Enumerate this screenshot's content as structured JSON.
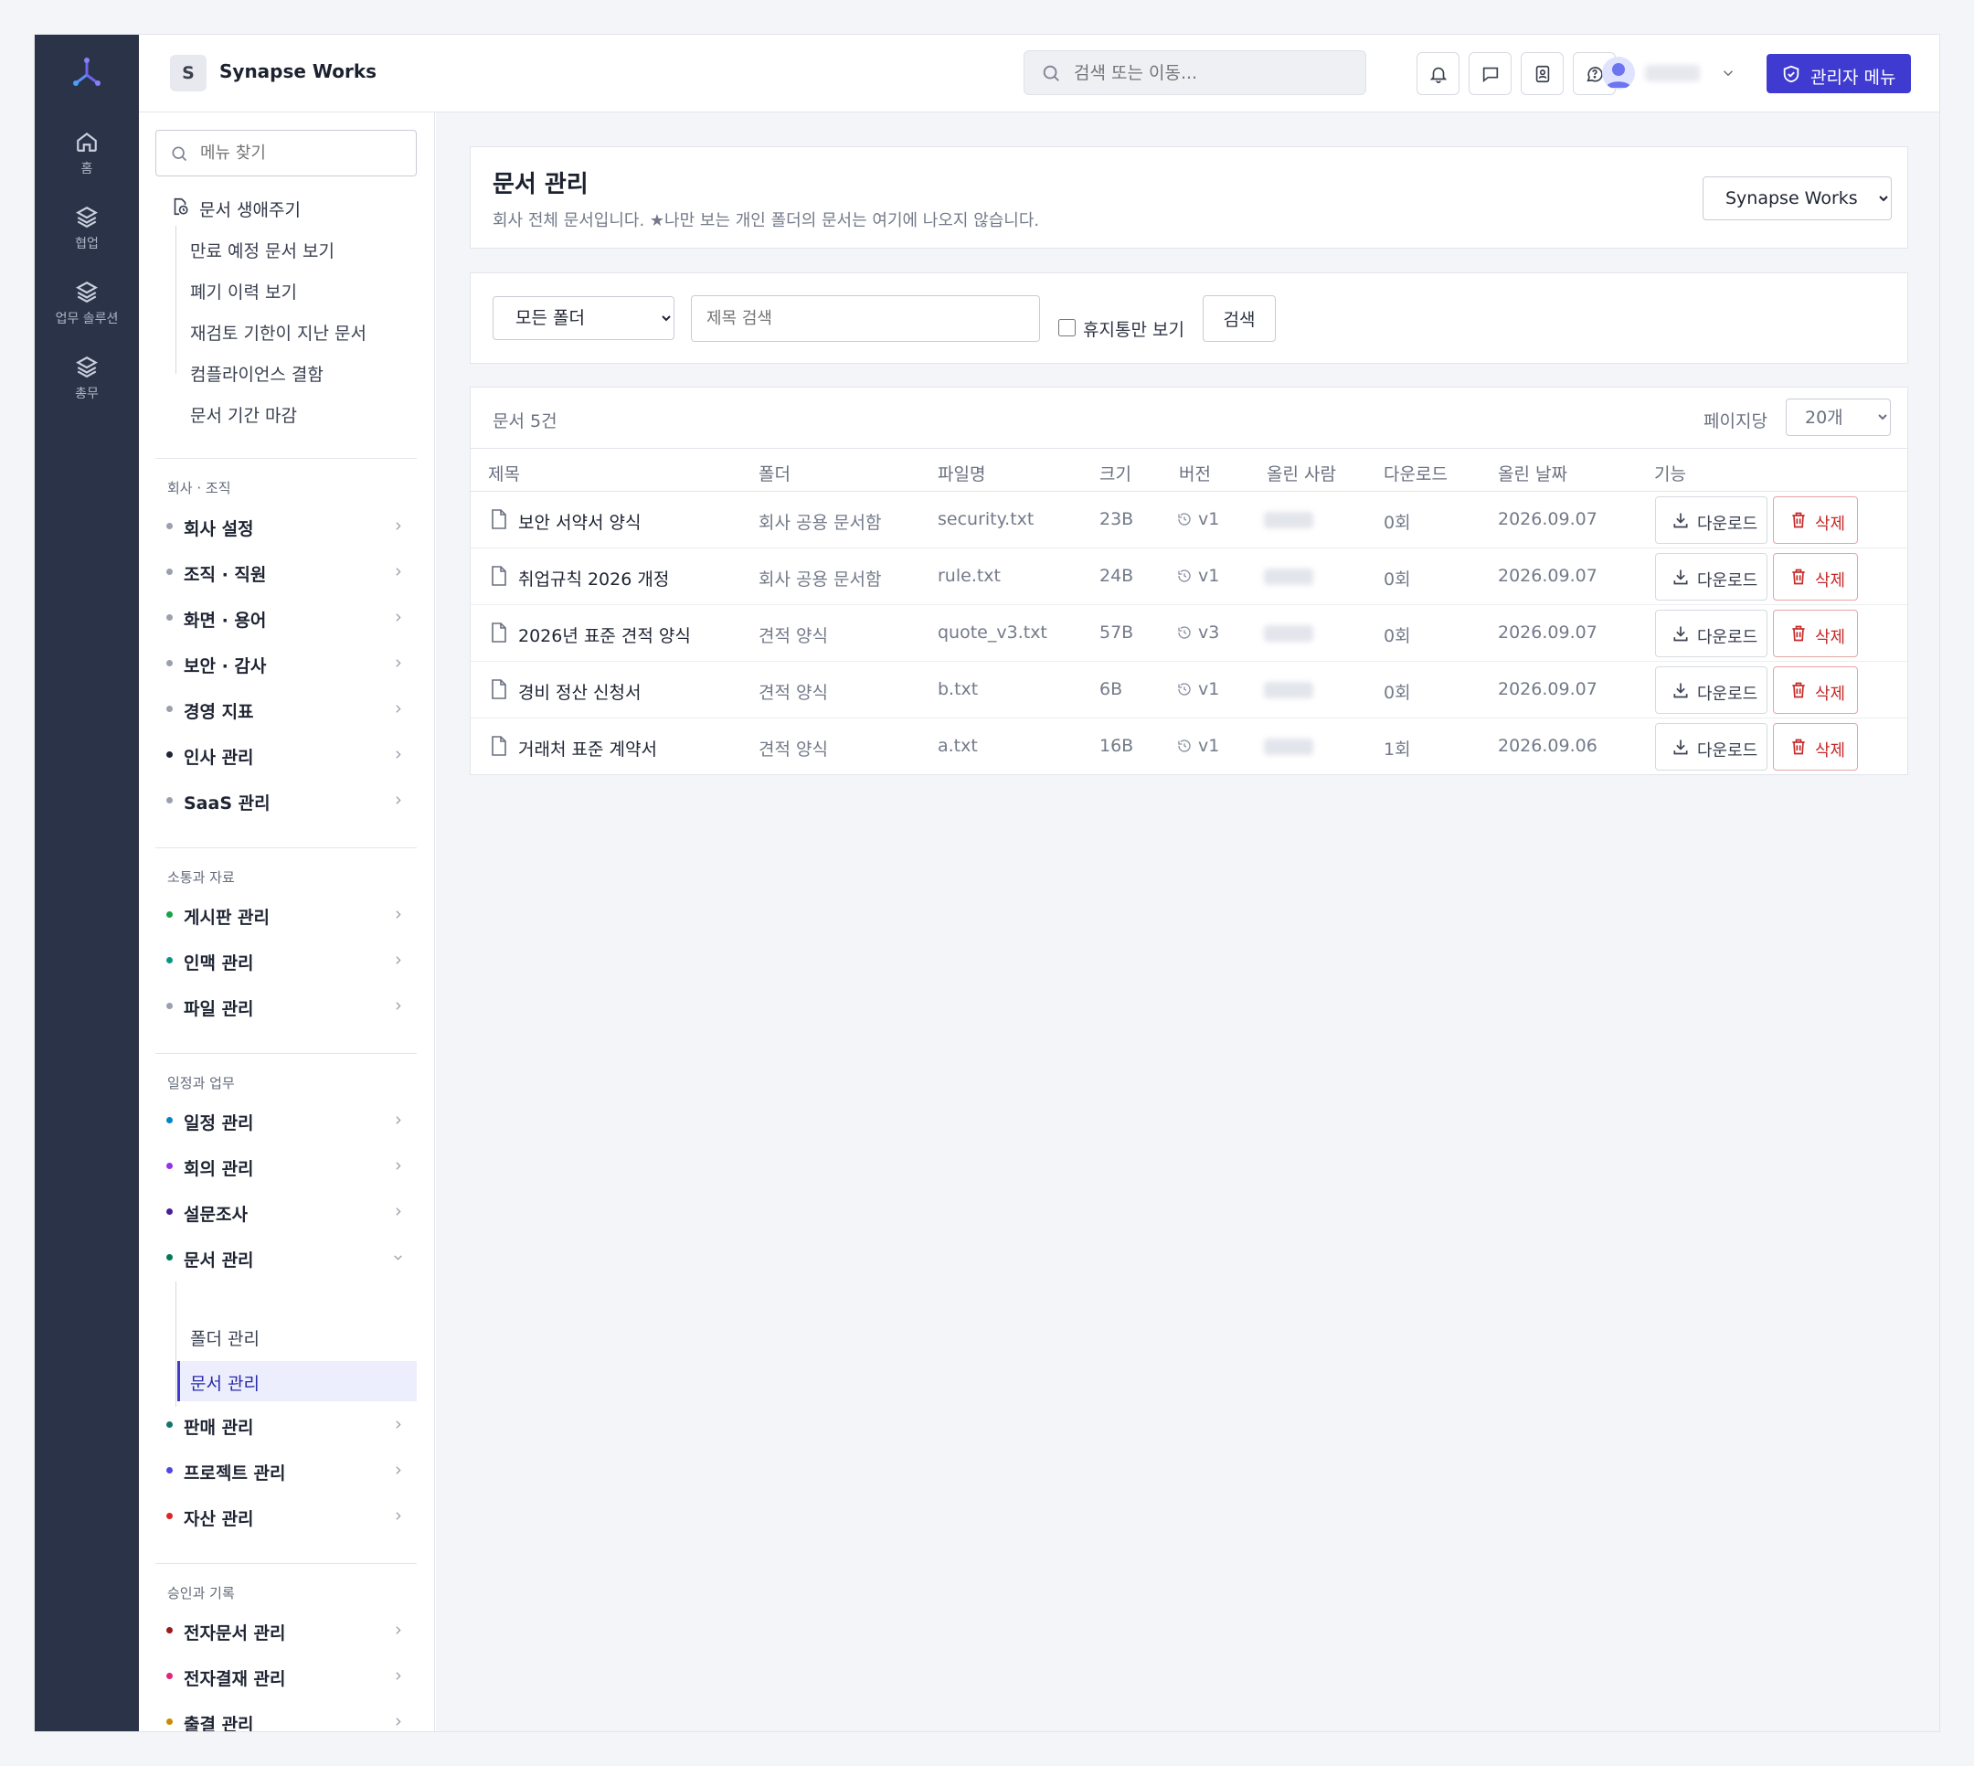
{
  "topbar": {
    "org_initial": "S",
    "org_name": "Synapse Works",
    "search_placeholder": "검색 또는 이동...",
    "admin_button": "관리자 메뉴"
  },
  "rail": [
    {
      "label": "홈",
      "icon": "home-icon"
    },
    {
      "label": "협업",
      "icon": "layers-icon"
    },
    {
      "label": "업무 솔루션",
      "icon": "layers-icon"
    },
    {
      "label": "총무",
      "icon": "layers-icon"
    }
  ],
  "sidebar": {
    "search_placeholder": "메뉴 찾기",
    "lifecycle": {
      "title": "문서 생애주기",
      "items": [
        "만료 예정 문서 보기",
        "폐기 이력 보기",
        "재검토 기한이 지난 문서",
        "컴플라이언스 결함",
        "문서 기간 마감"
      ]
    },
    "sections": [
      {
        "title": "회사 · 조직",
        "items": [
          {
            "label": "회사 설정",
            "dot": "#9aa0ae"
          },
          {
            "label": "조직 · 직원",
            "dot": "#9aa0ae"
          },
          {
            "label": "화면 · 용어",
            "dot": "#9aa0ae"
          },
          {
            "label": "보안 · 감사",
            "dot": "#9aa0ae"
          },
          {
            "label": "경영 지표",
            "dot": "#9aa0ae"
          },
          {
            "label": "인사 관리",
            "dot": "#1f2433"
          },
          {
            "label": "SaaS 관리",
            "dot": "#9aa0ae"
          }
        ]
      },
      {
        "title": "소통과 자료",
        "items": [
          {
            "label": "게시판 관리",
            "dot": "#16a34a"
          },
          {
            "label": "인맥 관리",
            "dot": "#0d9488"
          },
          {
            "label": "파일 관리",
            "dot": "#9aa0ae"
          }
        ]
      },
      {
        "title": "일정과 업무",
        "items": [
          {
            "label": "일정 관리",
            "dot": "#0284c7"
          },
          {
            "label": "회의 관리",
            "dot": "#9333ea"
          },
          {
            "label": "설문조사",
            "dot": "#4c1d95"
          },
          {
            "label": "문서 관리",
            "dot": "#047857"
          },
          {
            "label": "판매 관리",
            "dot": "#0f766e"
          },
          {
            "label": "프로젝트 관리",
            "dot": "#4f46e5"
          },
          {
            "label": "자산 관리",
            "dot": "#dc2626"
          }
        ]
      },
      {
        "title": "승인과 기록",
        "items": [
          {
            "label": "전자문서 관리",
            "dot": "#991b1b"
          },
          {
            "label": "전자결재 관리",
            "dot": "#db2777"
          },
          {
            "label": "출결 관리",
            "dot": "#ca8a04"
          }
        ]
      }
    ],
    "doc_sub": [
      "폴더 관리",
      "문서 관리"
    ]
  },
  "header": {
    "title": "문서 관리",
    "description": "회사 전체 문서입니다. ★나만 보는 개인 폴더의 문서는 여기에 나오지 않습니다.",
    "org_select": "Synapse Works"
  },
  "filters": {
    "folder_select": "모든 폴더",
    "title_placeholder": "제목 검색",
    "trash_label": "휴지통만 보기",
    "search_button": "검색"
  },
  "list": {
    "count": "문서 5건",
    "perpage_label": "페이지당",
    "perpage_value": "20개",
    "columns": [
      "제목",
      "폴더",
      "파일명",
      "크기",
      "버전",
      "올린 사람",
      "다운로드",
      "올린 날짜",
      "기능"
    ],
    "download_label": "다운로드",
    "delete_label": "삭제",
    "rows": [
      {
        "title": "보안 서약서 양식",
        "folder": "회사 공용 문서함",
        "file": "security.txt",
        "size": "23B",
        "version": "v1",
        "downloads": "0회",
        "date": "2026.09.07"
      },
      {
        "title": "취업규칙 2026 개정",
        "folder": "회사 공용 문서함",
        "file": "rule.txt",
        "size": "24B",
        "version": "v1",
        "downloads": "0회",
        "date": "2026.09.07"
      },
      {
        "title": "2026년 표준 견적 양식",
        "folder": "견적 양식",
        "file": "quote_v3.txt",
        "size": "57B",
        "version": "v3",
        "downloads": "0회",
        "date": "2026.09.07"
      },
      {
        "title": "경비 정산 신청서",
        "folder": "견적 양식",
        "file": "b.txt",
        "size": "6B",
        "version": "v1",
        "downloads": "0회",
        "date": "2026.09.07"
      },
      {
        "title": "거래처 표준 계약서",
        "folder": "견적 양식",
        "file": "a.txt",
        "size": "16B",
        "version": "v1",
        "downloads": "1회",
        "date": "2026.09.06"
      }
    ]
  },
  "colors": {
    "accent": "#3f3bd1",
    "rail_bg": "#2a3347",
    "danger": "#c62828"
  }
}
